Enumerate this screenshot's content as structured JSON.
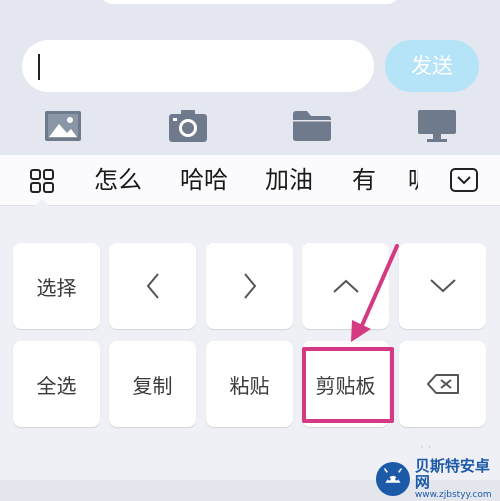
{
  "compose": {
    "input_value": "",
    "send_label": "发送",
    "send_color": "#b5e3f7",
    "tools": [
      {
        "icon": "image-icon"
      },
      {
        "icon": "camera-icon"
      },
      {
        "icon": "folder-icon"
      },
      {
        "icon": "computer-icon"
      }
    ]
  },
  "candidates": {
    "items": [
      "怎么",
      "哈哈",
      "加油",
      "有"
    ],
    "partial": "呢"
  },
  "keys": {
    "select": "选择",
    "left": "<",
    "right": ">",
    "up": "^",
    "down": "v",
    "select_all": "全选",
    "copy": "复制",
    "paste": "粘贴",
    "clipboard": "剪贴板"
  },
  "annotation": {
    "color": "#d33a82"
  },
  "watermark": {
    "title": "贝斯特安卓网",
    "url": "www.zjbstyy.com"
  }
}
